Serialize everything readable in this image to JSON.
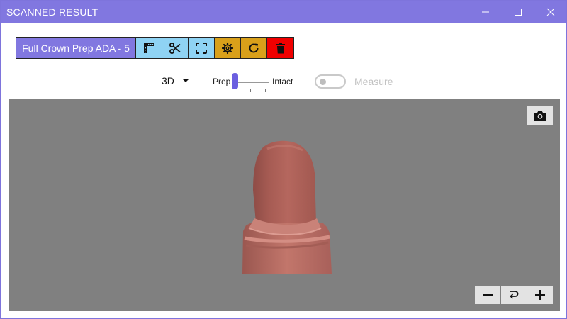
{
  "window": {
    "title": "SCANNED RESULT",
    "controls": [
      "minimize-icon",
      "maximize-icon",
      "close-icon"
    ],
    "accent_color": "#8177e0"
  },
  "toolbar": {
    "procedure_label": "Full Crown Prep ADA - 5",
    "buttons": [
      {
        "icon": "ruler-icon",
        "color": "#8fd3f4"
      },
      {
        "icon": "scissors-icon",
        "color": "#8fd3f4"
      },
      {
        "icon": "crop-frame-icon",
        "color": "#8fd3f4"
      },
      {
        "icon": "gear-icon",
        "color": "#d9a01a"
      },
      {
        "icon": "refresh-icon",
        "color": "#d9a01a"
      },
      {
        "icon": "trash-icon",
        "color": "#f00000"
      }
    ]
  },
  "view_controls": {
    "view_mode": "3D",
    "slider_left_label": "Prep",
    "slider_right_label": "Intact",
    "slider_value": 0,
    "measure_label": "Measure",
    "measure_enabled": false
  },
  "viewport": {
    "background_color": "#808080",
    "model_color": "#b86a60",
    "camera_icon": "camera-icon",
    "zoom_controls": [
      "minus-icon",
      "reset-view-icon",
      "plus-icon"
    ]
  }
}
